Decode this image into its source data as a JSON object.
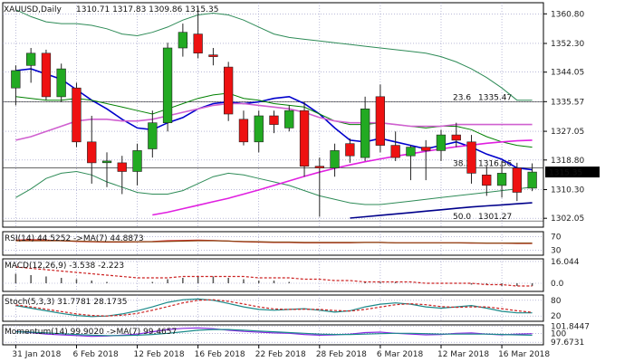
{
  "chart_data": {
    "type": "candlestick",
    "symbol_label": "XAUUSD,Daily",
    "ohlc_label": "1310.71 1317.83 1309.86 1315.35",
    "last_price": 1315.35,
    "ylim": [
      1299.5,
      1364.0
    ],
    "yticks": [
      1302.05,
      1310.3,
      1318.8,
      1327.05,
      1335.57,
      1344.05,
      1352.3,
      1360.8
    ],
    "ytick_labels": [
      "1302.05",
      "1310.30",
      "1318.80",
      "1327.05",
      "1335.57",
      "1344.05",
      "1352.30",
      "1360.80"
    ],
    "x_labels": [
      {
        "index": 0,
        "label": "31 Jan 2018"
      },
      {
        "index": 4,
        "label": "6 Feb 2018"
      },
      {
        "index": 8,
        "label": "12 Feb 2018"
      },
      {
        "index": 12,
        "label": "16 Feb 2018"
      },
      {
        "index": 16,
        "label": "22 Feb 2018"
      },
      {
        "index": 20,
        "label": "28 Feb 2018"
      },
      {
        "index": 24,
        "label": "6 Mar 2018"
      },
      {
        "index": 28,
        "label": "12 Mar 2018"
      },
      {
        "index": 32,
        "label": "16 Mar 2018"
      }
    ],
    "candles": [
      {
        "o": 1339.5,
        "h": 1346.0,
        "l": 1334.5,
        "c": 1344.5
      },
      {
        "o": 1346.0,
        "h": 1351.0,
        "l": 1341.0,
        "c": 1349.5
      },
      {
        "o": 1349.5,
        "h": 1350.5,
        "l": 1336.0,
        "c": 1337.0
      },
      {
        "o": 1337.0,
        "h": 1346.5,
        "l": 1335.5,
        "c": 1345.0
      },
      {
        "o": 1339.5,
        "h": 1341.0,
        "l": 1322.5,
        "c": 1324.0
      },
      {
        "o": 1324.0,
        "h": 1331.5,
        "l": 1312.0,
        "c": 1318.0
      },
      {
        "o": 1318.0,
        "h": 1321.0,
        "l": 1311.0,
        "c": 1318.5
      },
      {
        "o": 1318.0,
        "h": 1320.0,
        "l": 1309.0,
        "c": 1315.5
      },
      {
        "o": 1315.5,
        "h": 1323.5,
        "l": 1311.5,
        "c": 1321.5
      },
      {
        "o": 1322.0,
        "h": 1333.0,
        "l": 1319.5,
        "c": 1329.5
      },
      {
        "o": 1329.5,
        "h": 1352.5,
        "l": 1327.0,
        "c": 1351.0
      },
      {
        "o": 1351.0,
        "h": 1358.0,
        "l": 1348.5,
        "c": 1355.5
      },
      {
        "o": 1355.0,
        "h": 1362.5,
        "l": 1348.0,
        "c": 1349.5
      },
      {
        "o": 1349.0,
        "h": 1351.0,
        "l": 1346.0,
        "c": 1348.5
      },
      {
        "o": 1345.5,
        "h": 1347.0,
        "l": 1330.0,
        "c": 1332.0
      },
      {
        "o": 1330.5,
        "h": 1333.0,
        "l": 1323.0,
        "c": 1324.0
      },
      {
        "o": 1324.0,
        "h": 1333.0,
        "l": 1321.0,
        "c": 1331.5
      },
      {
        "o": 1331.5,
        "h": 1333.0,
        "l": 1326.5,
        "c": 1329.0
      },
      {
        "o": 1328.0,
        "h": 1334.5,
        "l": 1327.0,
        "c": 1333.0
      },
      {
        "o": 1333.0,
        "h": 1335.5,
        "l": 1314.0,
        "c": 1317.0
      },
      {
        "o": 1317.0,
        "h": 1319.5,
        "l": 1302.5,
        "c": 1316.5
      },
      {
        "o": 1316.5,
        "h": 1323.5,
        "l": 1314.0,
        "c": 1321.5
      },
      {
        "o": 1323.5,
        "h": 1325.0,
        "l": 1318.0,
        "c": 1320.0
      },
      {
        "o": 1319.5,
        "h": 1337.0,
        "l": 1318.5,
        "c": 1333.5
      },
      {
        "o": 1337.0,
        "h": 1340.5,
        "l": 1321.0,
        "c": 1323.0
      },
      {
        "o": 1323.0,
        "h": 1327.0,
        "l": 1318.5,
        "c": 1319.5
      },
      {
        "o": 1320.0,
        "h": 1323.0,
        "l": 1313.0,
        "c": 1322.5
      },
      {
        "o": 1322.5,
        "h": 1324.5,
        "l": 1313.0,
        "c": 1321.5
      },
      {
        "o": 1321.5,
        "h": 1327.5,
        "l": 1318.5,
        "c": 1326.0
      },
      {
        "o": 1326.0,
        "h": 1329.5,
        "l": 1322.5,
        "c": 1324.5
      },
      {
        "o": 1324.0,
        "h": 1326.0,
        "l": 1312.0,
        "c": 1315.0
      },
      {
        "o": 1314.5,
        "h": 1317.0,
        "l": 1308.5,
        "c": 1311.5
      },
      {
        "o": 1311.5,
        "h": 1318.5,
        "l": 1308.0,
        "c": 1315.0
      },
      {
        "o": 1316.5,
        "h": 1318.0,
        "l": 1307.0,
        "c": 1309.5
      },
      {
        "o": 1310.71,
        "h": 1317.83,
        "l": 1309.86,
        "c": 1315.35
      }
    ],
    "ma_series": [
      {
        "name": "blue",
        "color": "#0000cc",
        "values": [
          1344.5,
          1345.0,
          1343.5,
          1342.0,
          1339.0,
          1336.0,
          1333.5,
          1330.5,
          1328.0,
          1327.5,
          1329.5,
          1331.0,
          1333.5,
          1335.0,
          1335.5,
          1335.0,
          1335.5,
          1336.5,
          1337.0,
          1335.0,
          1332.0,
          1328.0,
          1324.5,
          1324.0,
          1325.0,
          1324.0,
          1323.0,
          1322.0,
          1323.0,
          1324.0,
          1322.5,
          1320.5,
          1319.0,
          1316.5,
          1316.0
        ]
      },
      {
        "name": "green",
        "color": "#008000",
        "values": [
          1337.0,
          1336.5,
          1336.0,
          1336.0,
          1336.5,
          1336.0,
          1335.0,
          1334.0,
          1333.0,
          1332.0,
          1333.5,
          1335.0,
          1336.5,
          1337.5,
          1338.0,
          1336.5,
          1336.0,
          1335.0,
          1334.5,
          1334.0,
          1332.0,
          1330.0,
          1329.0,
          1329.0,
          1329.5,
          1329.0,
          1328.5,
          1328.0,
          1328.5,
          1328.5,
          1327.5,
          1325.5,
          1324.0,
          1323.0,
          1322.5
        ]
      },
      {
        "name": "violet",
        "color": "#d060d0",
        "values": [
          1324.5,
          1325.5,
          1327.0,
          1328.5,
          1330.0,
          1330.5,
          1330.5,
          1330.0,
          1330.0,
          1330.5,
          1331.5,
          1332.5,
          1333.5,
          1334.5,
          1335.0,
          1335.0,
          1334.5,
          1334.0,
          1333.5,
          1332.5,
          1331.0,
          1330.0,
          1329.5,
          1329.5,
          1329.5,
          1329.0,
          1328.5,
          1328.5,
          1328.5,
          1329.0,
          1329.0,
          1329.0,
          1329.0,
          1329.0,
          1329.0
        ]
      },
      {
        "name": "bb-upper",
        "color": "#2e8b57",
        "values": [
          1362.0,
          1360.0,
          1358.5,
          1358.0,
          1358.0,
          1357.5,
          1356.5,
          1355.0,
          1354.5,
          1355.5,
          1357.0,
          1359.0,
          1360.5,
          1361.0,
          1360.5,
          1359.0,
          1357.0,
          1355.0,
          1354.0,
          1353.5,
          1353.0,
          1352.5,
          1352.0,
          1351.5,
          1351.0,
          1350.5,
          1350.0,
          1349.5,
          1348.5,
          1347.0,
          1345.0,
          1342.5,
          1339.5,
          1336.0,
          1336.0
        ]
      },
      {
        "name": "bb-lower",
        "color": "#2e8b57",
        "values": [
          1308.0,
          1310.5,
          1313.5,
          1315.0,
          1315.5,
          1314.5,
          1312.5,
          1311.0,
          1309.5,
          1309.0,
          1309.0,
          1310.0,
          1312.0,
          1314.0,
          1315.0,
          1314.5,
          1313.5,
          1312.5,
          1311.5,
          1310.0,
          1308.5,
          1307.5,
          1306.5,
          1306.0,
          1306.0,
          1306.5,
          1307.0,
          1307.5,
          1308.0,
          1308.5,
          1309.0,
          1309.5,
          1310.0,
          1310.5,
          1311.0
        ]
      },
      {
        "name": "dark-blue",
        "color": "#00008b",
        "values": [
          null,
          null,
          null,
          null,
          null,
          null,
          null,
          null,
          null,
          null,
          null,
          null,
          null,
          null,
          null,
          null,
          null,
          null,
          null,
          null,
          null,
          null,
          1302.1,
          1302.5,
          1302.9,
          1303.3,
          1303.7,
          1304.1,
          1304.5,
          1304.9,
          1305.3,
          1305.6,
          1305.9,
          1306.2,
          1306.5
        ]
      },
      {
        "name": "magenta-trend",
        "color": "#e020e0",
        "values": [
          null,
          null,
          null,
          null,
          null,
          null,
          null,
          null,
          null,
          1303.0,
          1303.8,
          1304.8,
          1305.8,
          1306.8,
          1307.8,
          1309.0,
          1310.2,
          1311.5,
          1312.8,
          1314.1,
          1315.3,
          1316.4,
          1317.4,
          1318.3,
          1319.1,
          1319.9,
          1320.6,
          1321.3,
          1322.0,
          1322.6,
          1323.1,
          1323.6,
          1324.0,
          1324.3,
          1324.5
        ]
      }
    ],
    "fib_levels": [
      {
        "label": "23.6",
        "value_label": "1335.47",
        "value": 1335.47
      },
      {
        "label": "38.2",
        "value_label": "1316.56",
        "value": 1316.56
      },
      {
        "label": "50.0",
        "value_label": "1301.27",
        "value": 1301.27
      }
    ],
    "colors": {
      "bull": "#22aa22",
      "bear": "#ee1111",
      "grid": "#9090c0",
      "axis": "#000000"
    },
    "indicators": [
      {
        "id": "rsi",
        "label": "RSI(14) 44.5252 ->MA(7) 44.8873",
        "ylim": [
          15,
          85
        ],
        "yticks": [
          {
            "v": 70,
            "label": "70"
          },
          {
            "v": 30,
            "label": "30"
          }
        ],
        "lines": [
          {
            "color": "#cc2222",
            "values": [
              60,
              61,
              60,
              58,
              56,
              55,
              54,
              54,
              55,
              56,
              58,
              59,
              60,
              59,
              57,
              55,
              54,
              53,
              53,
              52,
              52,
              52,
              52,
              53,
              53,
              52,
              52,
              52,
              52,
              52,
              51,
              51,
              51,
              50,
              50
            ]
          },
          {
            "color": "#8b4513",
            "values": [
              58,
              58,
              58,
              58,
              57,
              56,
              55,
              55,
              55,
              55,
              56,
              57,
              58,
              58,
              57,
              56,
              55,
              54,
              54,
              53,
              53,
              53,
              53,
              53,
              53,
              52,
              52,
              52,
              52,
              52,
              52,
              51,
              51,
              51,
              51
            ]
          }
        ]
      },
      {
        "id": "macd",
        "label": "MACD(12,26,9) -3.538 -2.223",
        "ylim": [
          -6,
          18
        ],
        "yticks": [
          {
            "v": 16.044,
            "label": "16.044"
          },
          {
            "v": 0,
            "label": "0.0"
          }
        ],
        "histogram": [
          7,
          6,
          5,
          4,
          3,
          2,
          1,
          0,
          0,
          1,
          3,
          4,
          5,
          5,
          4,
          3,
          2,
          2,
          1,
          0,
          0,
          0,
          0,
          1,
          1,
          1,
          0,
          0,
          0,
          0,
          -1,
          -1,
          -2,
          -2,
          -2
        ],
        "lines": [
          {
            "color": "#cc2222",
            "dashed": true,
            "values": [
              12,
              11,
              10,
              9,
              8,
              7,
              6,
              5,
              4,
              4,
              4,
              5,
              5,
              5,
              5,
              5,
              4,
              4,
              4,
              3,
              3,
              2,
              2,
              1,
              1,
              1,
              1,
              0,
              0,
              0,
              0,
              -1,
              -1,
              -2,
              -2
            ]
          }
        ]
      },
      {
        "id": "stoch",
        "label": "Stoch(5,3,3) 31.7781 28.1735",
        "ylim": [
          0,
          100
        ],
        "yticks": [
          {
            "v": 80,
            "label": "80"
          },
          {
            "v": 20,
            "label": "20"
          }
        ],
        "lines": [
          {
            "color": "#1a8a8a",
            "values": [
              60,
              50,
              40,
              30,
              22,
              18,
              20,
              28,
              40,
              55,
              72,
              82,
              85,
              80,
              68,
              55,
              45,
              42,
              45,
              48,
              42,
              35,
              40,
              55,
              65,
              70,
              65,
              55,
              50,
              55,
              60,
              50,
              38,
              32,
              32
            ]
          },
          {
            "color": "#cc2222",
            "dashed": true,
            "values": [
              62,
              55,
              46,
              37,
              28,
              22,
              20,
              23,
              30,
              42,
              56,
              70,
              80,
              82,
              76,
              66,
              55,
              47,
              45,
              46,
              45,
              41,
              39,
              45,
              54,
              63,
              67,
              63,
              56,
              53,
              55,
              55,
              48,
              40,
              34
            ]
          }
        ]
      },
      {
        "id": "momentum",
        "label": "Momentum(14) 99.9020 ->MA(7) 99.4657",
        "ylim": [
          97.0,
          102.2
        ],
        "yticks": [
          {
            "v": 101.8447,
            "label": "101.8447"
          },
          {
            "v": 100,
            "label": "100"
          },
          {
            "v": 97.6731,
            "label": "97.6731"
          }
        ],
        "lines": [
          {
            "color": "#8a2be2",
            "values": [
              100.5,
              100.2,
              99.8,
              99.6,
              99.4,
              99.2,
              99.3,
              99.5,
              99.8,
              100.4,
              101.0,
              101.3,
              101.4,
              101.2,
              100.8,
              100.5,
              100.3,
              100.1,
              100.0,
              99.7,
              99.5,
              99.6,
              99.8,
              100.2,
              100.3,
              100.0,
              99.8,
              99.6,
              99.7,
              100.0,
              100.1,
              99.8,
              99.6,
              99.8,
              99.9
            ]
          },
          {
            "color": "#1a8a8a",
            "values": [
              100.4,
              100.3,
              100.1,
              99.9,
              99.7,
              99.5,
              99.4,
              99.4,
              99.5,
              99.7,
              100.0,
              100.4,
              100.8,
              101.0,
              101.0,
              100.8,
              100.6,
              100.4,
              100.2,
              100.0,
              99.8,
              99.7,
              99.7,
              99.8,
              99.9,
              100.0,
              100.0,
              99.9,
              99.8,
              99.8,
              99.8,
              99.8,
              99.7,
              99.6,
              99.5
            ]
          }
        ]
      }
    ]
  }
}
